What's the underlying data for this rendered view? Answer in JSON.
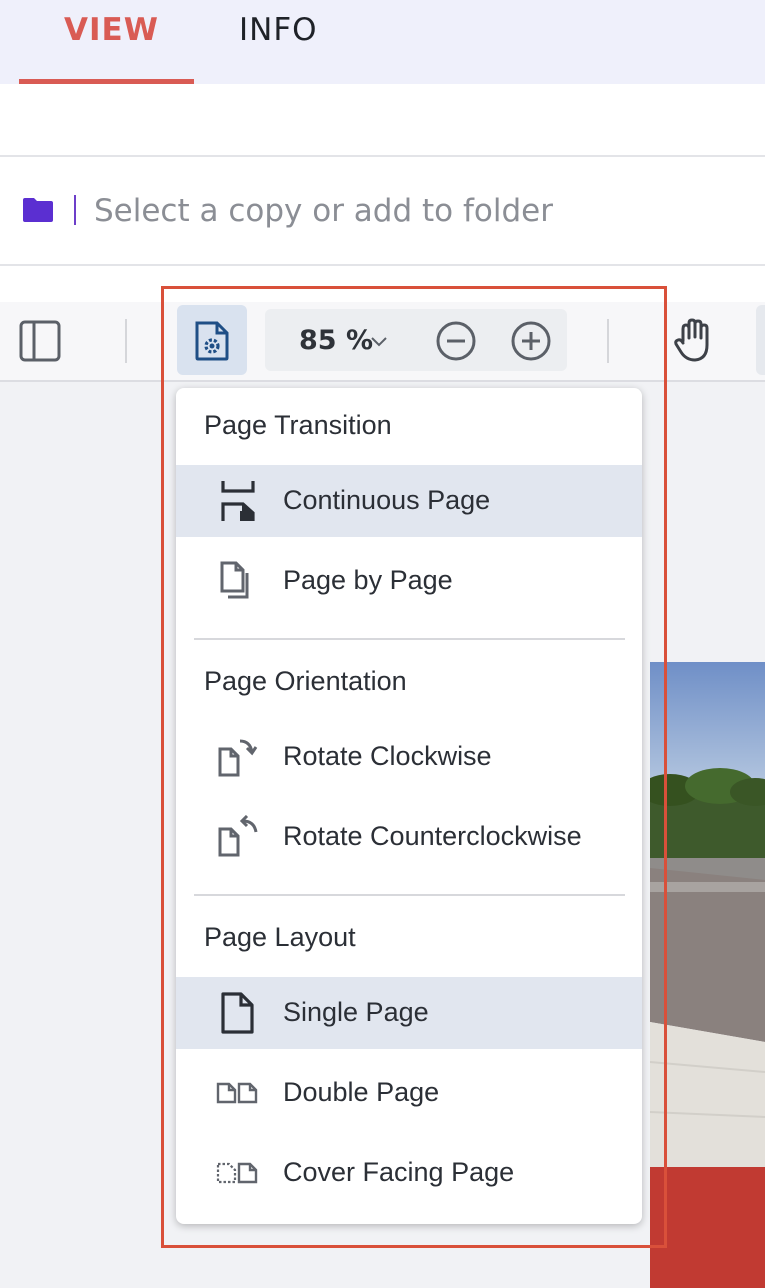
{
  "tabs": [
    {
      "label": "VIEW",
      "active": true
    },
    {
      "label": "INFO",
      "active": false
    }
  ],
  "folder": {
    "placeholder": "Select a copy or add to folder",
    "icon": "folder-icon",
    "icon_color": "#5b2fd1"
  },
  "toolbar": {
    "zoom_value": "85 %",
    "icons": [
      "sidebar-toggle-icon",
      "page-settings-icon",
      "chevron-down-icon",
      "zoom-out-icon",
      "zoom-in-icon",
      "pan-hand-icon"
    ]
  },
  "menu": {
    "sections": [
      {
        "title": "Page Transition",
        "items": [
          {
            "label": "Continuous Page",
            "icon": "continuous-page-icon",
            "selected": true
          },
          {
            "label": "Page by Page",
            "icon": "page-by-page-icon",
            "selected": false
          }
        ]
      },
      {
        "title": "Page Orientation",
        "items": [
          {
            "label": "Rotate Clockwise",
            "icon": "rotate-clockwise-icon",
            "selected": false
          },
          {
            "label": "Rotate Counterclockwise",
            "icon": "rotate-counterclockwise-icon",
            "selected": false
          }
        ]
      },
      {
        "title": "Page Layout",
        "items": [
          {
            "label": "Single Page",
            "icon": "single-page-icon",
            "selected": true
          },
          {
            "label": "Double Page",
            "icon": "double-page-icon",
            "selected": false
          },
          {
            "label": "Cover Facing Page",
            "icon": "cover-facing-page-icon",
            "selected": false
          }
        ]
      }
    ]
  },
  "colors": {
    "accent": "#d95b54",
    "highlight_border": "#d9503a",
    "selected_item_bg": "#e1e6ef"
  }
}
